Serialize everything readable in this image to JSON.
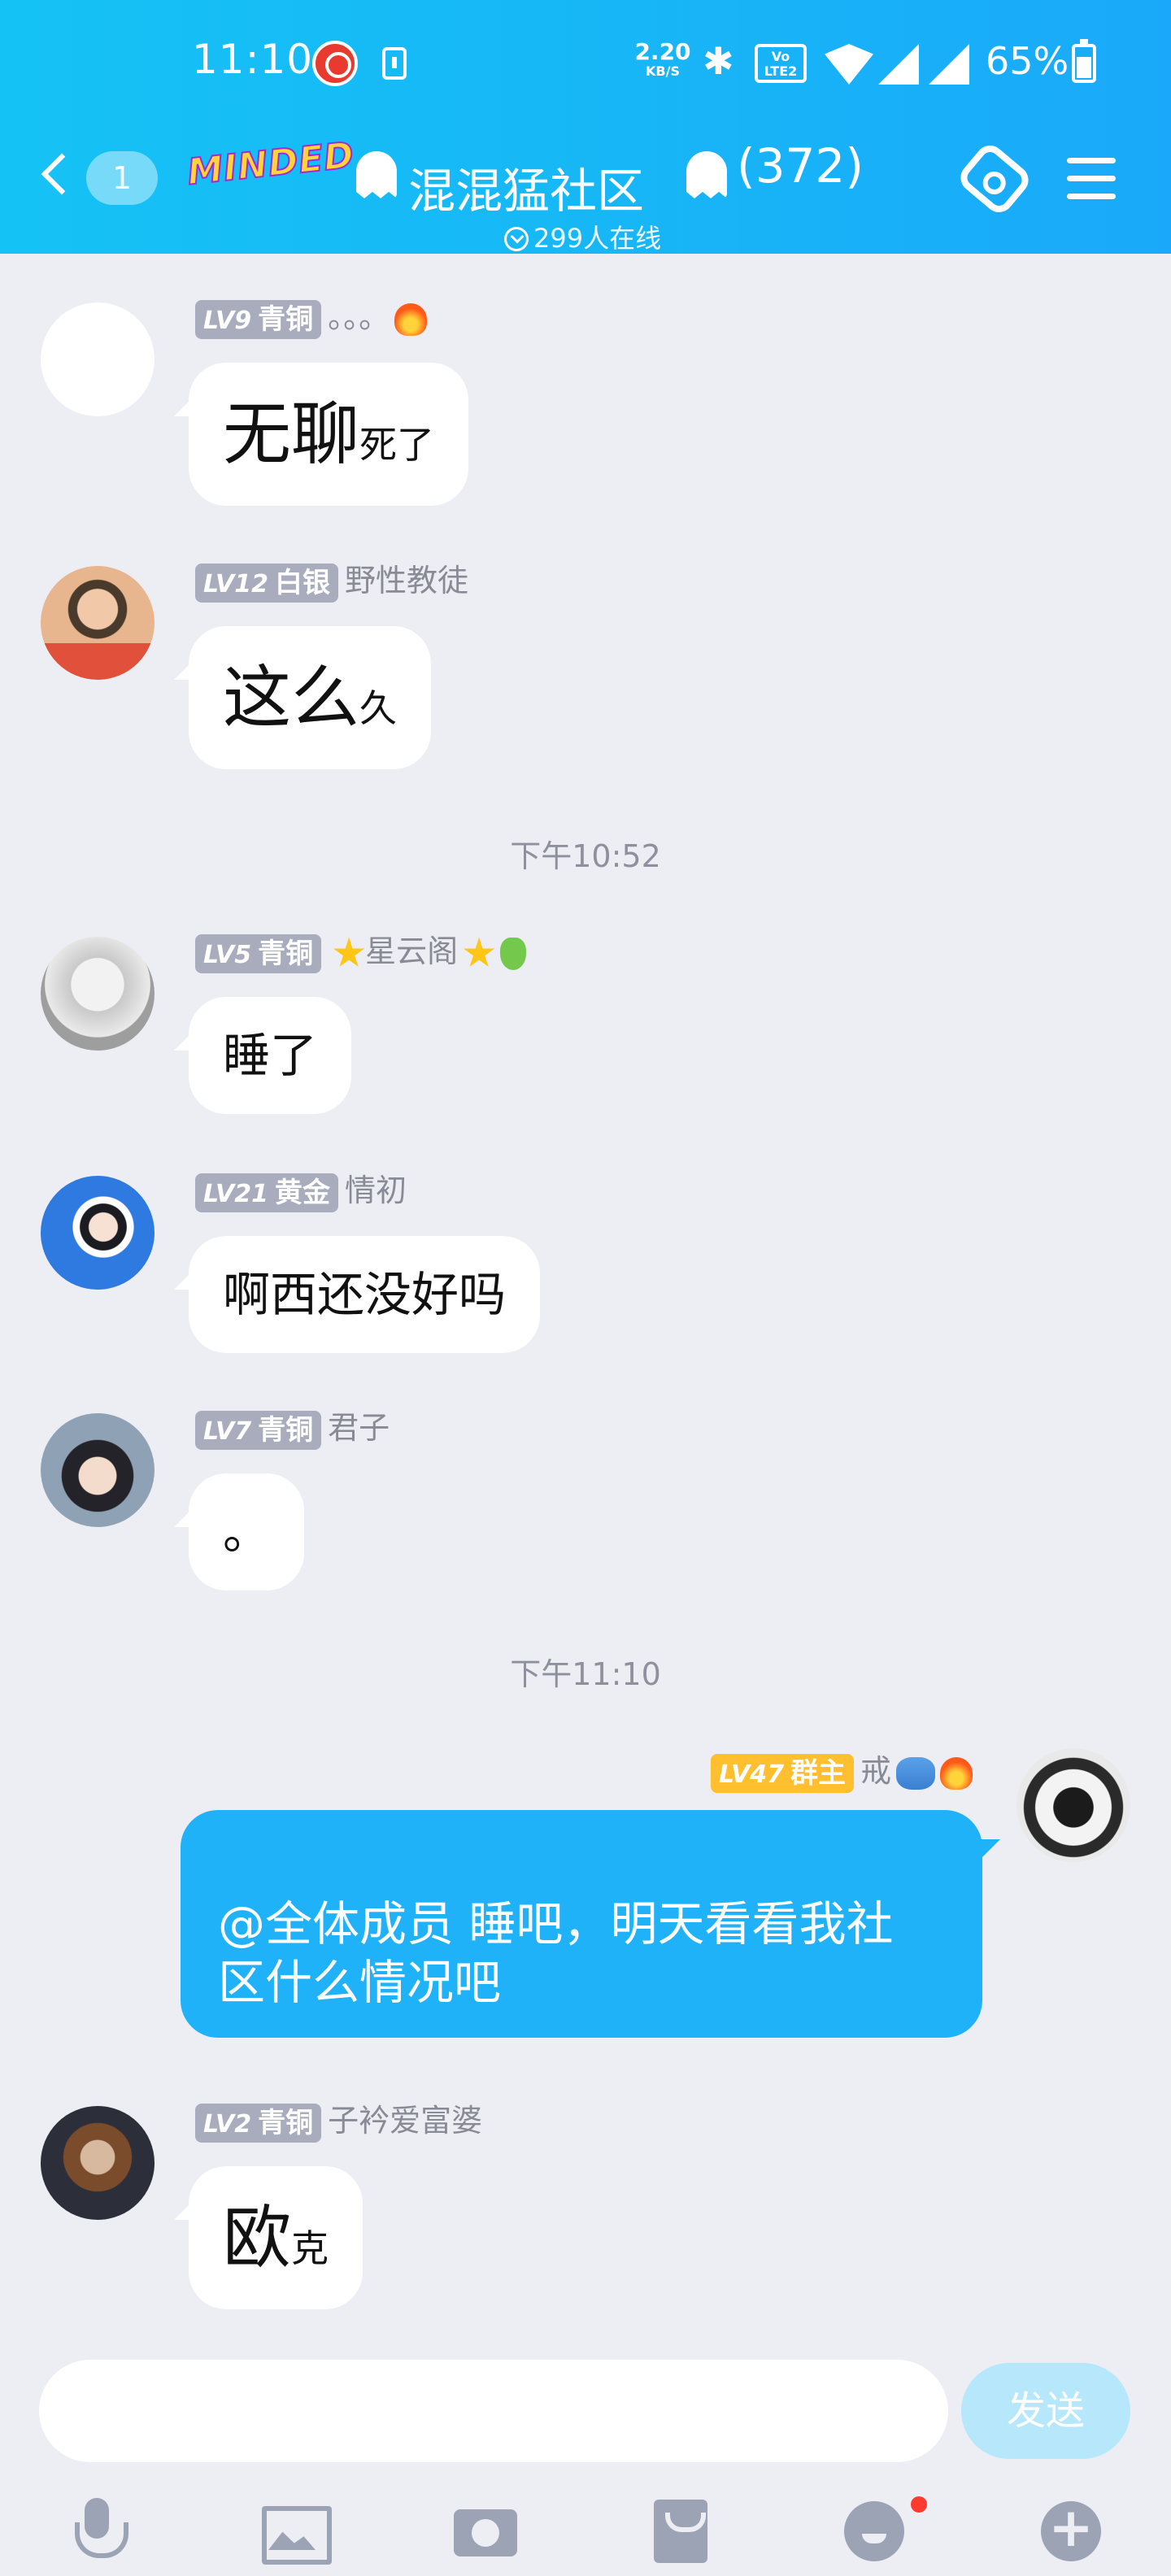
{
  "status_bar": {
    "time": "11:10",
    "net_speed": "2.20",
    "net_speed_unit": "KB/S",
    "volte": "Vo LTE2",
    "battery": "65%"
  },
  "header": {
    "unread_count": "1",
    "logo_text": "MINDED",
    "group_name": "混混猛社区",
    "member_count": "(372)",
    "online_text": "299人在线"
  },
  "messages": [
    {
      "lv": "LV9",
      "rank": "青铜",
      "name": "。。。",
      "text_big": "无聊",
      "text_small": "死了"
    },
    {
      "lv": "LV12",
      "rank": "白银",
      "name": "野性教徒",
      "text_big": "这么",
      "text_small": "久"
    },
    {
      "lv": "LV5",
      "rank": "青铜",
      "name": "星云阁",
      "text": "睡了"
    },
    {
      "lv": "LV21",
      "rank": "黄金",
      "name": "情初",
      "text": "啊西还没好吗"
    },
    {
      "lv": "LV7",
      "rank": "青铜",
      "name": "君子",
      "text": "。"
    },
    {
      "lv": "LV47",
      "rank": "群主",
      "name": "戒",
      "text": "@全体成员 睡吧，明天看看我社区什么情况吧"
    },
    {
      "lv": "LV2",
      "rank": "青铜",
      "name": "子衿爱富婆",
      "text_big": "欧",
      "text_small": "克"
    }
  ],
  "time_separators": [
    "下午10:52",
    "下午11:10"
  ],
  "self_message_lines": [
    "@全体成员 睡吧，明天看看我社",
    "区什么情况吧"
  ],
  "input": {
    "value": "",
    "placeholder": ""
  },
  "send_label": "发送",
  "colors": {
    "header": "#17b7f6",
    "self_bubble": "#1fb2f8",
    "send_disabled": "#b6e7fb",
    "owner_badge": "#ffbf2f"
  }
}
